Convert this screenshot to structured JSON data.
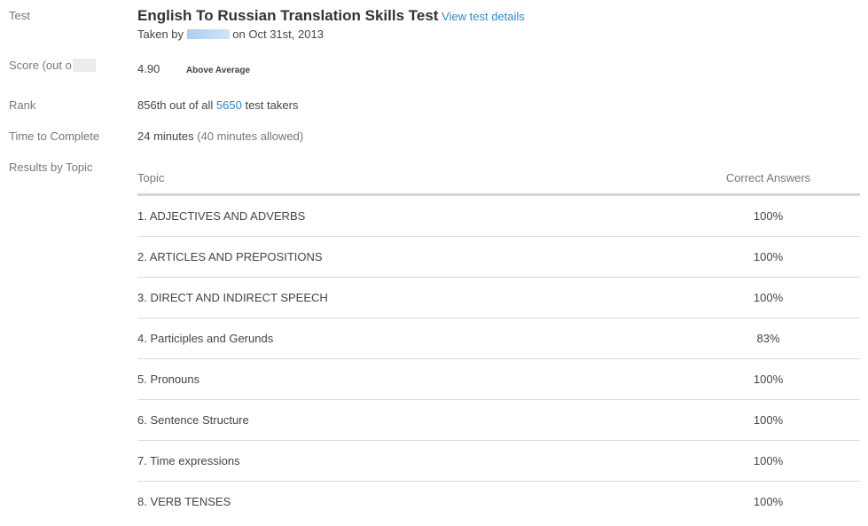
{
  "labels": {
    "test": "Test",
    "score": "Score (out o",
    "rank": "Rank",
    "time": "Time to Complete",
    "results": "Results by Topic"
  },
  "test": {
    "title": "English To Russian Translation Skills Test",
    "details_link": "View test details",
    "taken_by_prefix": "Taken by",
    "taken_date": "on Oct 31st, 2013"
  },
  "score": {
    "value": "4.90",
    "badge": "Above Average"
  },
  "rank": {
    "prefix": "856th out of all",
    "total": "5650",
    "suffix": "test takers"
  },
  "time": {
    "taken": "24 minutes",
    "allowed": "(40 minutes allowed)"
  },
  "table": {
    "headers": {
      "topic": "Topic",
      "correct": "Correct Answers"
    },
    "rows": [
      {
        "topic": "1. ADJECTIVES AND ADVERBS",
        "correct": "100%"
      },
      {
        "topic": "2. ARTICLES AND PREPOSITIONS",
        "correct": "100%"
      },
      {
        "topic": "3. DIRECT AND INDIRECT SPEECH",
        "correct": "100%"
      },
      {
        "topic": "4. Participles and Gerunds",
        "correct": "83%"
      },
      {
        "topic": "5. Pronouns",
        "correct": "100%"
      },
      {
        "topic": "6. Sentence Structure",
        "correct": "100%"
      },
      {
        "topic": "7. Time expressions",
        "correct": "100%"
      },
      {
        "topic": "8. VERB TENSES",
        "correct": "100%"
      }
    ]
  },
  "colors": {
    "link": "#2e8ac4",
    "label": "#777777",
    "text": "#444444",
    "header_rule": "#d6d6d6"
  }
}
